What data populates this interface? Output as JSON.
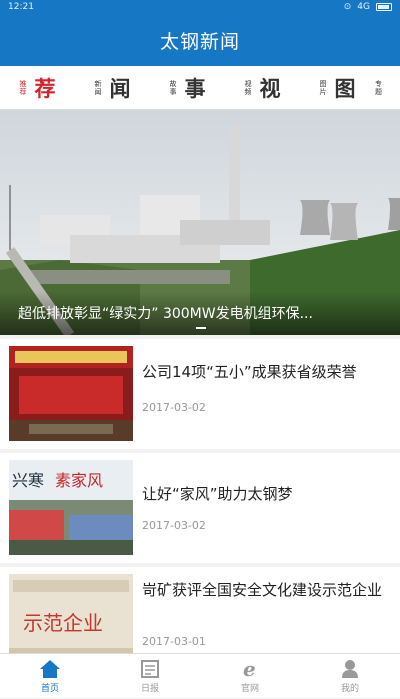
{
  "status_bar": {
    "time": "12:21",
    "network": "4G"
  },
  "header": {
    "title": "太钢新闻"
  },
  "tabs": [
    {
      "small": "推荐",
      "big": "荐",
      "active": true
    },
    {
      "small": "新闻",
      "big": "闻",
      "active": false
    },
    {
      "small": "故事",
      "big": "事",
      "active": false
    },
    {
      "small": "视频",
      "big": "视",
      "active": false
    },
    {
      "small": "图片",
      "big": "图",
      "active": false
    },
    {
      "small": "专题",
      "big": "",
      "active": false
    }
  ],
  "banner": {
    "caption": "超低排放彰显“绿实力” 300MW发电机组环保..."
  },
  "news": [
    {
      "title": "公司14项“五小”成果获省级荣誉",
      "date": "2017-03-02",
      "thumb_text": ""
    },
    {
      "title": "让好“家风”助力太钢梦",
      "date": "2017-03-02",
      "thumb_text": "兴寒 素家风"
    },
    {
      "title": "岢矿获评全国安全文化建设示范企业",
      "date": "2017-03-01",
      "thumb_text": "示范企业"
    }
  ],
  "bottom_nav": [
    {
      "label": "首页",
      "icon": "home-icon",
      "active": true
    },
    {
      "label": "日报",
      "icon": "newspaper-icon",
      "active": false
    },
    {
      "label": "官网",
      "icon": "browser-icon",
      "active": false
    },
    {
      "label": "我的",
      "icon": "user-icon",
      "active": false
    }
  ],
  "colors": {
    "primary": "#1677c4",
    "accent": "#d4232b"
  }
}
